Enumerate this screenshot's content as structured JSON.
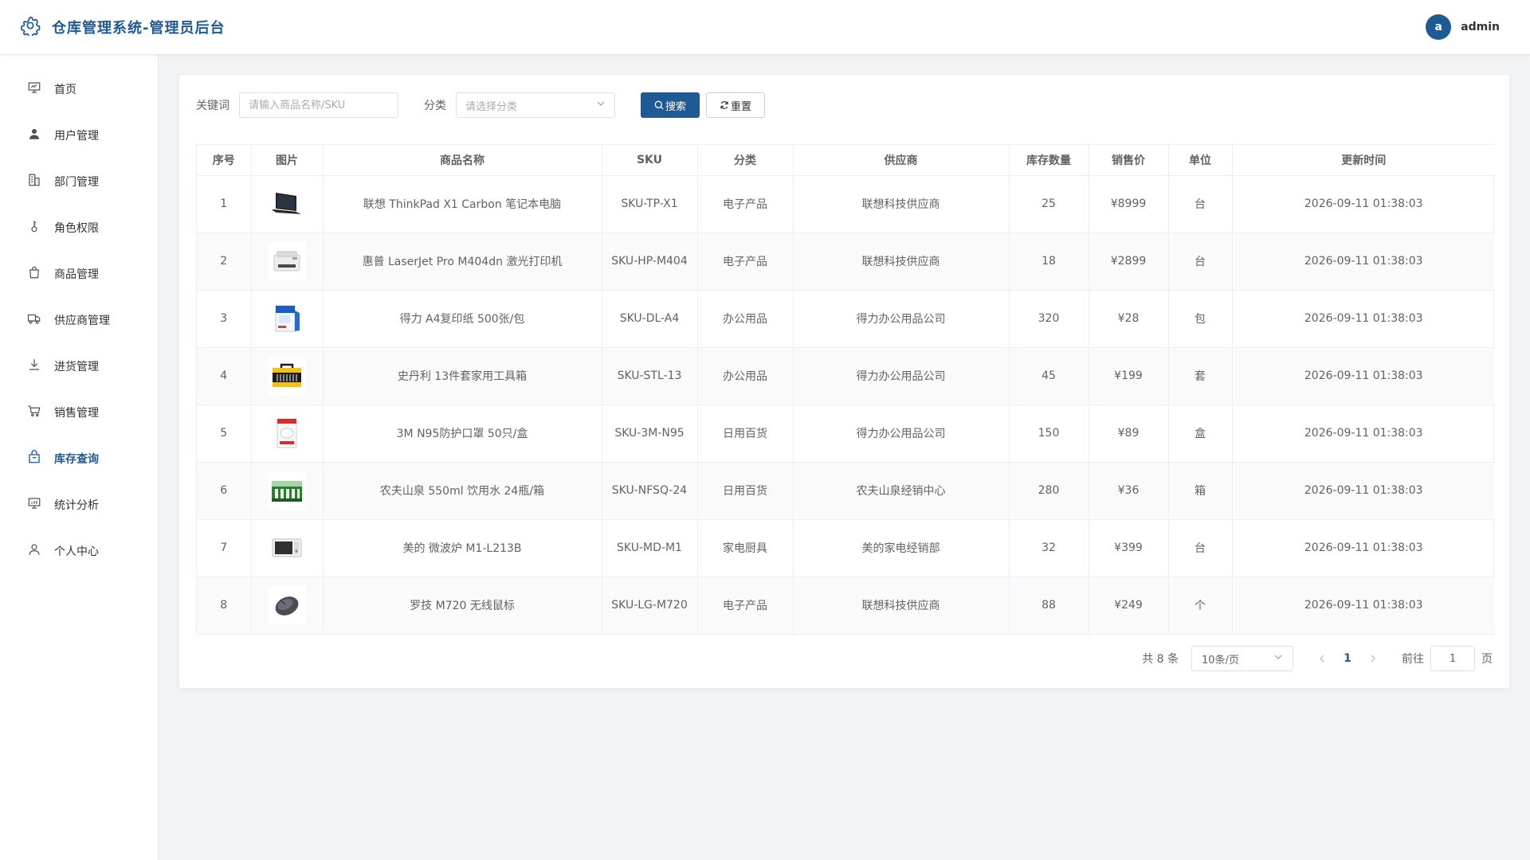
{
  "header": {
    "title": "仓库管理系统-管理员后台",
    "avatar_letter": "a",
    "username": "admin"
  },
  "sidebar": {
    "items": [
      {
        "label": "首页",
        "icon": "monitor-icon"
      },
      {
        "label": "用户管理",
        "icon": "user-filled-icon"
      },
      {
        "label": "部门管理",
        "icon": "office-building-icon"
      },
      {
        "label": "角色权限",
        "icon": "key-icon"
      },
      {
        "label": "商品管理",
        "icon": "shopping-bag-icon"
      },
      {
        "label": "供应商管理",
        "icon": "truck-icon"
      },
      {
        "label": "进货管理",
        "icon": "download-icon"
      },
      {
        "label": "销售管理",
        "icon": "shopping-cart-icon"
      },
      {
        "label": "库存查询",
        "icon": "inventory-box-icon",
        "active": true
      },
      {
        "label": "统计分析",
        "icon": "chart-monitor-icon"
      },
      {
        "label": "个人中心",
        "icon": "user-outline-icon"
      }
    ]
  },
  "filter": {
    "keyword_label": "关键词",
    "keyword_value": "",
    "keyword_placeholder": "请输入商品名称/SKU",
    "category_label": "分类",
    "category_placeholder": "请选择分类",
    "search_label": "搜索",
    "reset_label": "重置"
  },
  "table": {
    "columns": [
      "序号",
      "图片",
      "商品名称",
      "SKU",
      "分类",
      "供应商",
      "库存数量",
      "销售价",
      "单位",
      "更新时间"
    ],
    "rows": [
      {
        "index": "1",
        "thumb": "laptop",
        "name": "联想 ThinkPad X1 Carbon 笔记本电脑",
        "sku": "SKU-TP-X1",
        "category": "电子产品",
        "supplier": "联想科技供应商",
        "stock": "25",
        "price": "¥8999",
        "unit": "台",
        "updated": "2026-09-11 01:38:03"
      },
      {
        "index": "2",
        "thumb": "printer",
        "name": "惠普 LaserJet Pro M404dn 激光打印机",
        "sku": "SKU-HP-M404",
        "category": "电子产品",
        "supplier": "联想科技供应商",
        "stock": "18",
        "price": "¥2899",
        "unit": "台",
        "updated": "2026-09-11 01:38:03"
      },
      {
        "index": "3",
        "thumb": "paper",
        "name": "得力 A4复印纸 500张/包",
        "sku": "SKU-DL-A4",
        "category": "办公用品",
        "supplier": "得力办公用品公司",
        "stock": "320",
        "price": "¥28",
        "unit": "包",
        "updated": "2026-09-11 01:38:03"
      },
      {
        "index": "4",
        "thumb": "toolbox",
        "name": "史丹利 13件套家用工具箱",
        "sku": "SKU-STL-13",
        "category": "办公用品",
        "supplier": "得力办公用品公司",
        "stock": "45",
        "price": "¥199",
        "unit": "套",
        "updated": "2026-09-11 01:38:03"
      },
      {
        "index": "5",
        "thumb": "mask",
        "name": "3M N95防护口罩 50只/盒",
        "sku": "SKU-3M-N95",
        "category": "日用百货",
        "supplier": "得力办公用品公司",
        "stock": "150",
        "price": "¥89",
        "unit": "盒",
        "updated": "2026-09-11 01:38:03"
      },
      {
        "index": "6",
        "thumb": "water",
        "name": "农夫山泉 550ml 饮用水 24瓶/箱",
        "sku": "SKU-NFSQ-24",
        "category": "日用百货",
        "supplier": "农夫山泉经销中心",
        "stock": "280",
        "price": "¥36",
        "unit": "箱",
        "updated": "2026-09-11 01:38:03"
      },
      {
        "index": "7",
        "thumb": "microwave",
        "name": "美的 微波炉 M1-L213B",
        "sku": "SKU-MD-M1",
        "category": "家电厨具",
        "supplier": "美的家电经销部",
        "stock": "32",
        "price": "¥399",
        "unit": "台",
        "updated": "2026-09-11 01:38:03"
      },
      {
        "index": "8",
        "thumb": "mouse",
        "name": "罗技 M720 无线鼠标",
        "sku": "SKU-LG-M720",
        "category": "电子产品",
        "supplier": "联想科技供应商",
        "stock": "88",
        "price": "¥249",
        "unit": "个",
        "updated": "2026-09-11 01:38:03"
      }
    ]
  },
  "pagination": {
    "total_text": "共 8 条",
    "page_size": "10条/页",
    "current_page": "1",
    "goto_label": "前往",
    "goto_value": "1",
    "page_suffix": "页"
  },
  "colors": {
    "primary": "#1f5a96",
    "text": "#303133",
    "muted": "#606266",
    "border": "#ebeef5",
    "background": "#f2f3f5"
  }
}
